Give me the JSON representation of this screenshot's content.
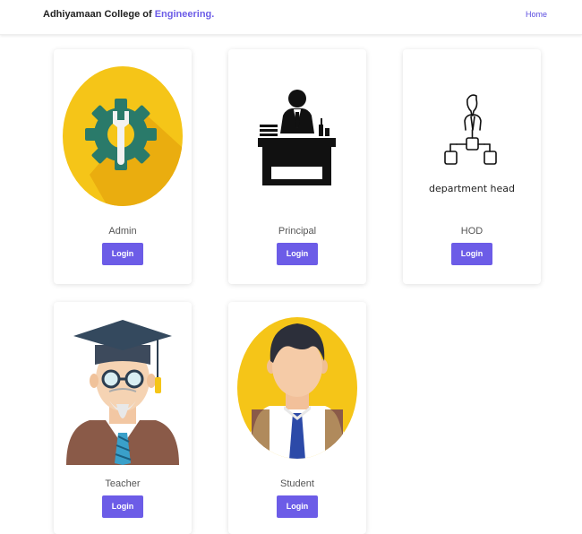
{
  "navbar": {
    "brand_prefix": "Adhiyamaan College of ",
    "brand_accent": "Engineering.",
    "home_link": "Home"
  },
  "colors": {
    "accent": "#6c5ce7",
    "admin_circle": "#f5c518",
    "admin_gear": "#2a7a6a"
  },
  "cards": [
    {
      "title": "Admin",
      "button": "Login",
      "icon": "admin-wrench-gear-icon"
    },
    {
      "title": "Principal",
      "button": "Login",
      "icon": "principal-desk-icon"
    },
    {
      "title": "HOD",
      "button": "Login",
      "icon": "department-head-icon",
      "image_caption": "department head"
    },
    {
      "title": "Teacher",
      "button": "Login",
      "icon": "teacher-graduate-icon"
    },
    {
      "title": "Student",
      "button": "Login",
      "icon": "student-avatar-icon"
    }
  ]
}
